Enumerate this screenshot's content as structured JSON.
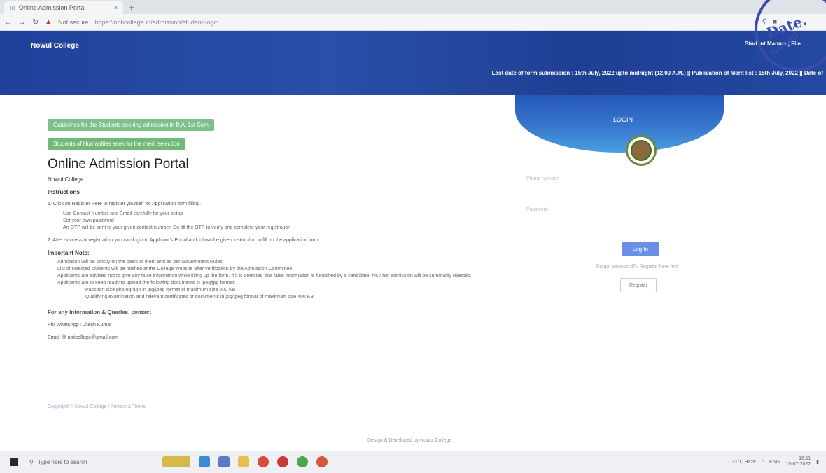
{
  "browser": {
    "tab_title": "Online Admission Portal",
    "tab_close": "×",
    "new_tab": "+",
    "not_secure": "Not secure",
    "url": "https://noticollege.in/admission/student-login"
  },
  "header": {
    "college_name": "Nowul College",
    "right_text": "Student Manual | File",
    "marquee": "Last date of form submission : 15th July, 2022 upto midnight (12.00 A.M.) || Publication of Merit list : 15th July, 2022 || Date of"
  },
  "content": {
    "badge_1": "Guidelines for the Students seeking admission in B.A. 1st Sem",
    "badge_2": "Students of Humanities seek for the merit selection",
    "portal_title": "Online Admission Portal",
    "college_sub": "Nowul College",
    "instructions_header": "Instructions",
    "step_1": "1. Click on Register Here to register yourself for Application form filling.",
    "sub_items": [
      "Use Contact Number and Email carefully for your setup",
      "Set your own password",
      "An OTP will be sent to your given contact number. Do fill the OTP to verify and complete your registration"
    ],
    "step_2": "2. After successful registration you can login to Applicant's Portal and follow the given instruction to fill up the application form.",
    "important_header": "Important Note:",
    "important_items": [
      "Admission will be strictly on the basis of merit and as per Government Rules",
      "List of selected students will be notified at the College Website after verification by the Admission Committee",
      "Applicants are advised not to give any false information while filling up the form. If it is detected that false information is furnished by a candidate, his / her admission will be summarily rejected.",
      "Applicants are to keep ready to upload the following documents in jpeg/jpg format:"
    ],
    "indent_items": [
      "Passport size photograph in jpg/jpeg format of maximum size 200 KB",
      "Qualifying examination and relevant certificates or documents in jpg/jpeg format of maximum size 400 KB"
    ],
    "contact_header": "For any information & Queries, contact",
    "contact_phone": "Ph/ WhatsApp : Jitesh Kumar",
    "contact_email": "Email @ noticollege@gmail.com",
    "footer_links": "Copyright © Nowul College | Privacy & Terms",
    "footer_center": "Design & Developed by Nowul College"
  },
  "login": {
    "title": "LOGIN",
    "username_label": "Phone number",
    "password_label": "Password",
    "login_button": "Log In",
    "forgot": "Forgot password? / Register here first",
    "register_button": "Register"
  },
  "stamp": {
    "line1": "Date.",
    "line2": "Nowul"
  },
  "taskbar": {
    "search_placeholder": "Type here to search",
    "weather": "31°C Haze",
    "time": "16:11",
    "date": "15-07-2022",
    "lang": "ENG"
  }
}
